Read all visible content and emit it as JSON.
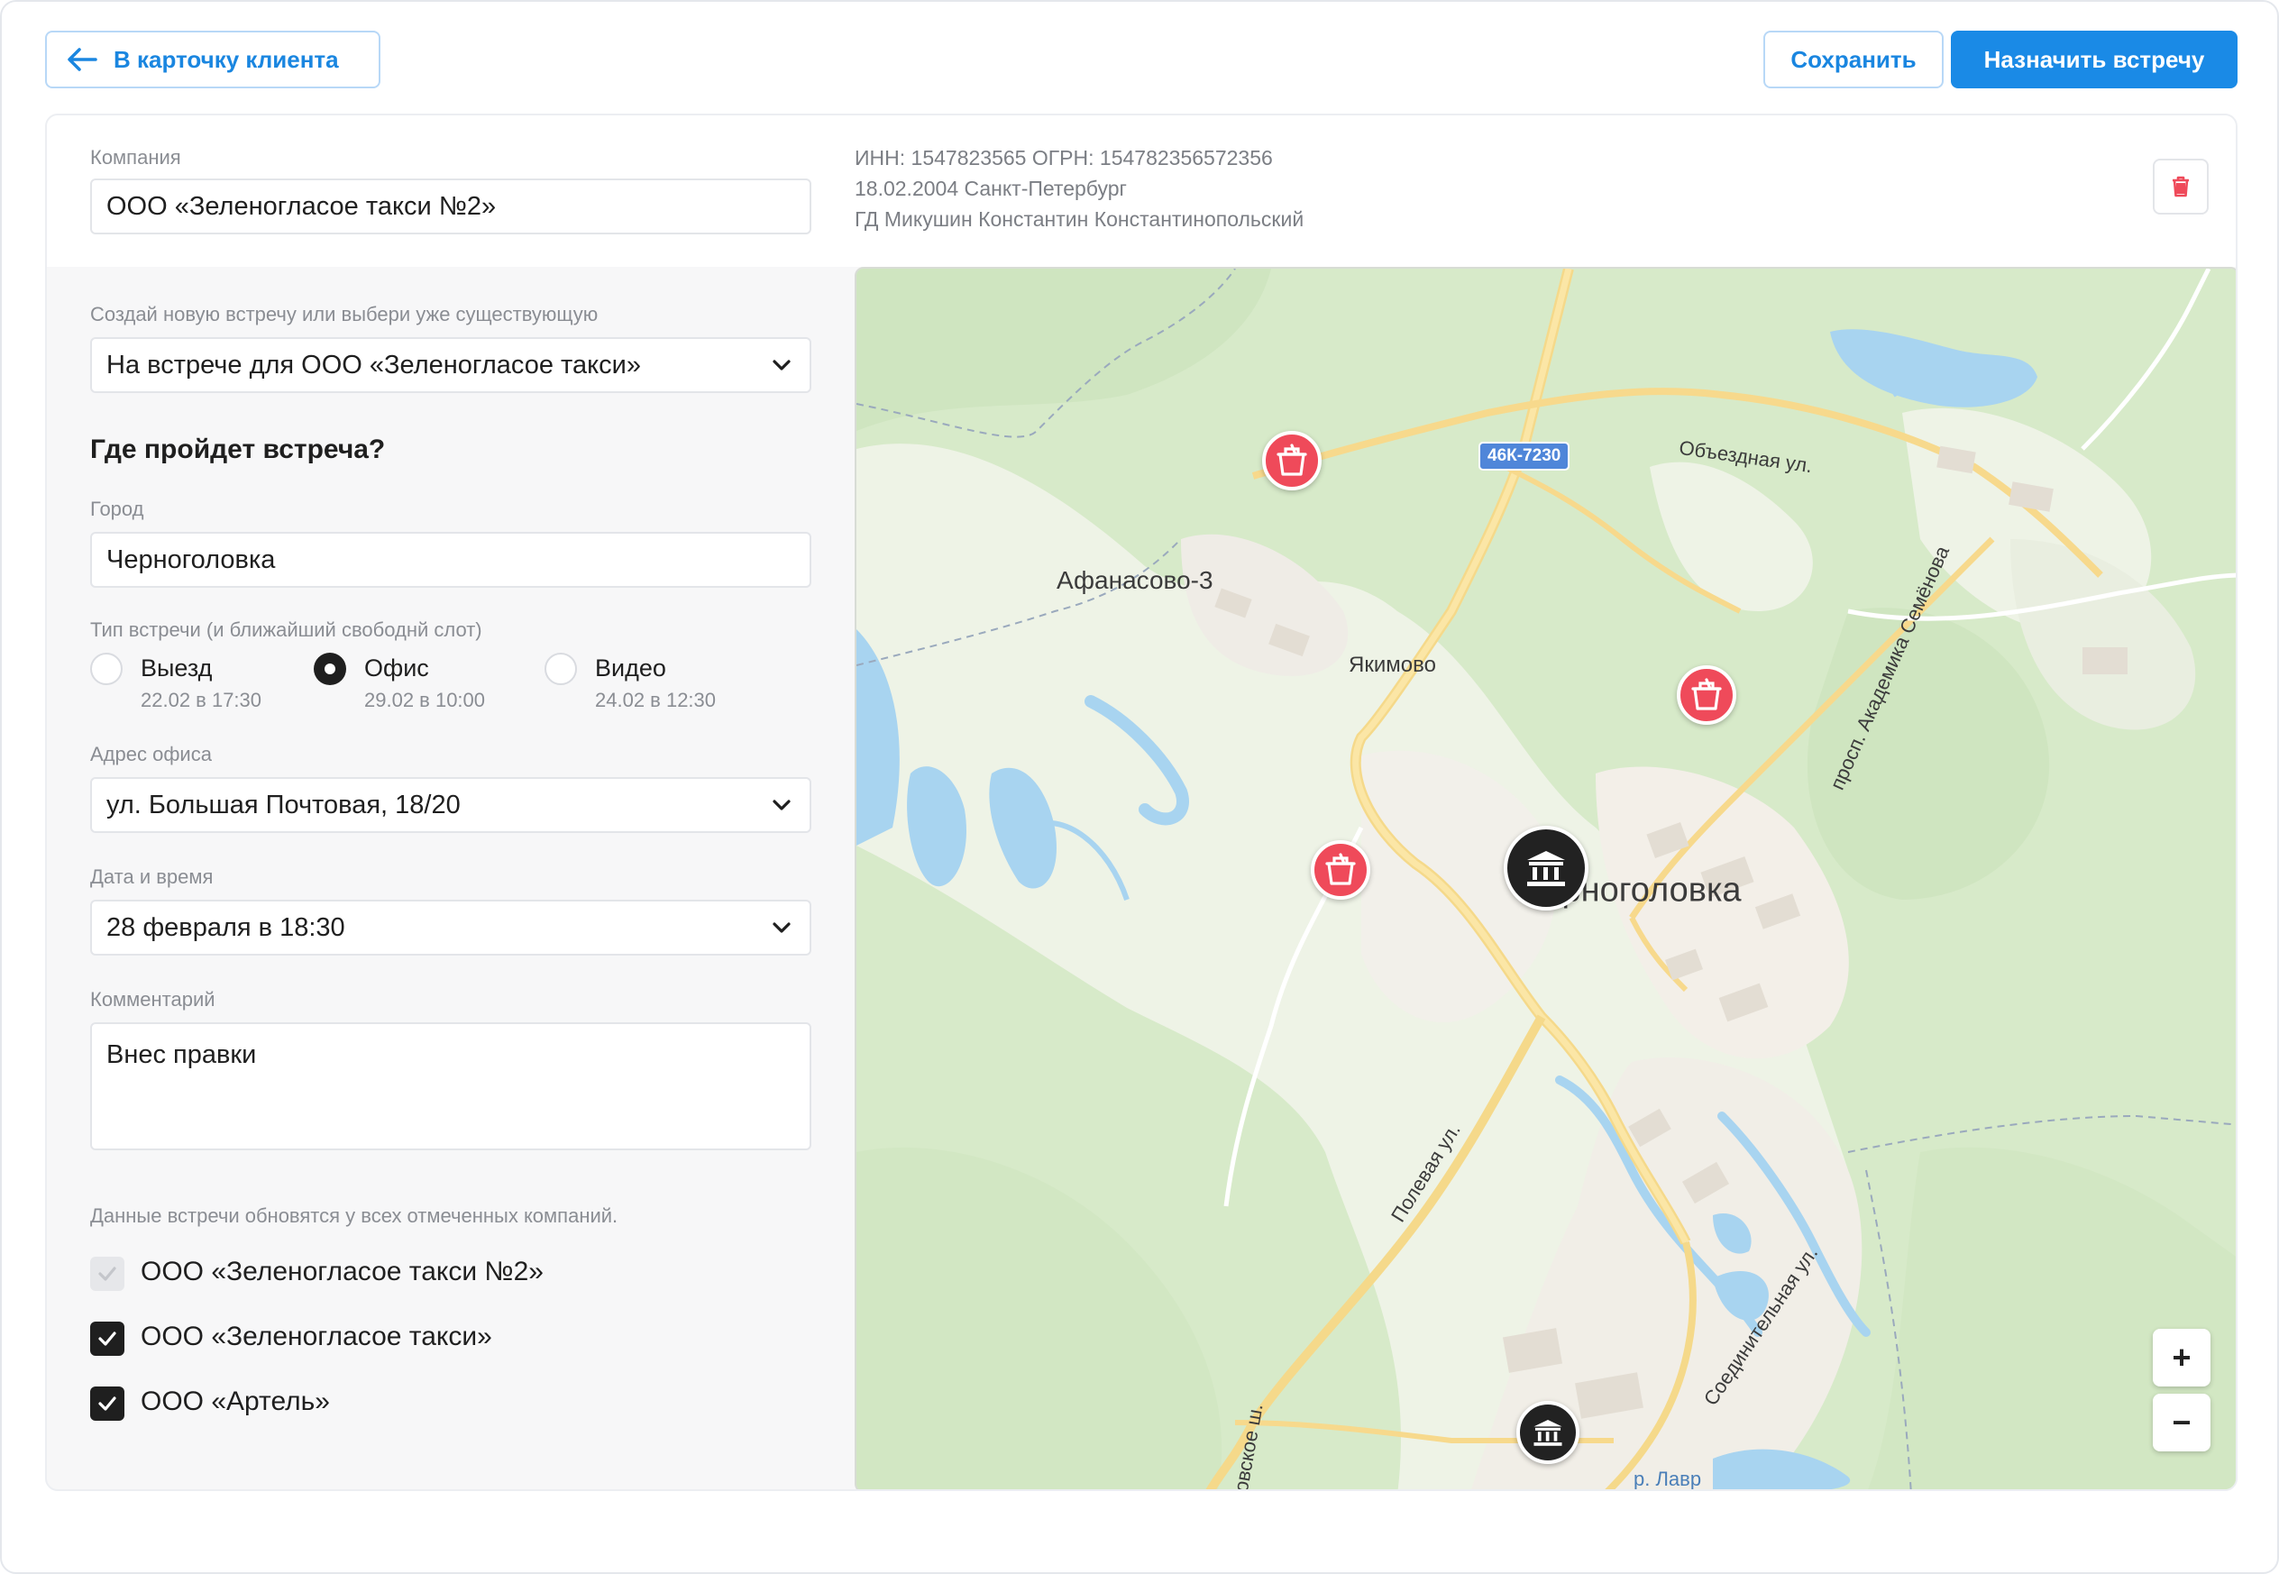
{
  "header": {
    "back_label": "В карточку клиента",
    "save_label": "Сохранить",
    "assign_label": "Назначить встречу"
  },
  "company": {
    "label": "Компания",
    "value": "ООО «Зеленогласое такси №2»",
    "inn_ogrn": "ИНН: 1547823565  ОГРН: 154782356572356",
    "reg": "18.02.2004 Санкт-Петербург",
    "director": "ГД Микушин Константин Константинопольский"
  },
  "form": {
    "meeting_select_label": "Создай новую встречу или выбери уже существующую",
    "meeting_select_value": "На встрече для ООО «Зеленогласое такси»",
    "where_title": "Где пройдет встреча?",
    "city_label": "Город",
    "city_value": "Черноголовка",
    "type_label": "Тип встречи (и ближайший свободнй слот)",
    "types": [
      {
        "label": "Выезд",
        "slot": "22.02 в 17:30",
        "selected": false
      },
      {
        "label": "Офис",
        "slot": "29.02 в 10:00",
        "selected": true
      },
      {
        "label": "Видео",
        "slot": "24.02 в 12:30",
        "selected": false
      }
    ],
    "address_label": "Адрес офиса",
    "address_value": "ул. Большая Почтовая, 18/20",
    "datetime_label": "Дата и время",
    "datetime_value": "28 февраля в 18:30",
    "comment_label": "Комментарий",
    "comment_value": "Внес правки",
    "note": "Данные встречи обновятся у всех отмеченных компаний.",
    "companies": [
      {
        "label": "ООО «Зеленогласое такси №2»",
        "checked": true,
        "disabled": true
      },
      {
        "label": "ООО «Зеленогласое такси»",
        "checked": true,
        "disabled": false
      },
      {
        "label": "ООО «Артель»",
        "checked": true,
        "disabled": false
      }
    ]
  },
  "map": {
    "places": {
      "afanasovo": "Афанасово-3",
      "yakimovo": "Якимово",
      "chernogolovka": "Черноголовка",
      "obezdnaya": "Объездная ул.",
      "akademika": "просп. Академика Семёнова",
      "polevaya": "Полевая ул.",
      "soedinitelnaya": "Соединительная ул.",
      "kovskoe": "ковское ш.",
      "river": "р. Лавр"
    },
    "road_shield": "46К-7230",
    "zoom_in": "+",
    "zoom_out": "−",
    "colors": {
      "accent": "#1a8ae6",
      "pin_red": "#ef4a5a",
      "pin_dark": "#222222"
    }
  }
}
